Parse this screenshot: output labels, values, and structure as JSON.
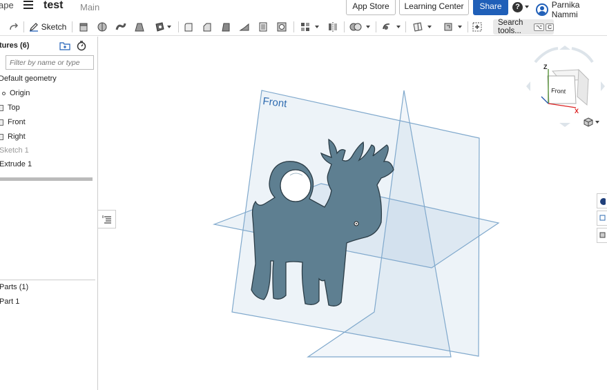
{
  "header": {
    "logo_fragment": "ape",
    "doc_title": "test",
    "branch": "Main",
    "app_store_label": "App Store",
    "learning_center_label": "Learning Center",
    "share_label": "Share",
    "help_glyph": "?",
    "user_name": "Parnika Nammi"
  },
  "toolbar": {
    "sketch_label": "Sketch",
    "search_label": "Search tools...",
    "search_shortcut_keys": [
      "⌥",
      "C"
    ]
  },
  "features": {
    "title": "tures (6)",
    "filter_placeholder": "Filter by name or type",
    "items": [
      {
        "label": "Default geometry",
        "icon": "none"
      },
      {
        "label": "Origin",
        "icon": "origin-icon"
      },
      {
        "label": "Top",
        "icon": "plane-icon"
      },
      {
        "label": "Front",
        "icon": "plane-icon"
      },
      {
        "label": "Right",
        "icon": "plane-icon"
      },
      {
        "label": "Sketch 1",
        "icon": "none",
        "dimmed": true
      },
      {
        "label": "Extrude 1",
        "icon": "none"
      }
    ]
  },
  "parts": {
    "title": "Parts (1)",
    "items": [
      {
        "label": "Part 1"
      }
    ]
  },
  "viewport": {
    "front_plane_label": "Front",
    "viewcube_face_label": "Front",
    "axis_z": "Z",
    "axis_x": "X",
    "part_color": "#5e7f91",
    "plane_color": "#7fa8cc"
  }
}
